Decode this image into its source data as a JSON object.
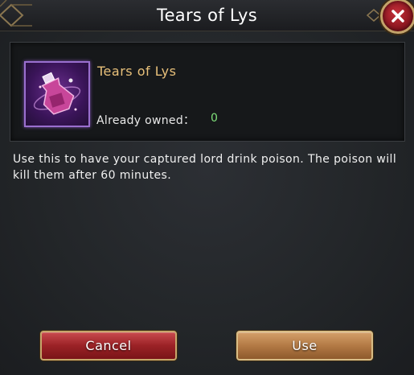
{
  "dialog": {
    "title": "Tears of Lys",
    "close_icon": "close-x-icon"
  },
  "item": {
    "name": "Tears of Lys",
    "icon": "poison-vial-icon",
    "owned_label": "Already owned：",
    "owned_value": "0",
    "description": "Use this to have your captured lord drink poison. The poison will kill them after 60 minutes."
  },
  "buttons": {
    "cancel_label": "Cancel",
    "use_label": "Use"
  },
  "colors": {
    "item_name": "#e8c07a",
    "owned_value": "#7fe07a",
    "cancel_button": "#9b2226",
    "use_button": "#b37a45",
    "frame_gold": "#c3a36a"
  }
}
